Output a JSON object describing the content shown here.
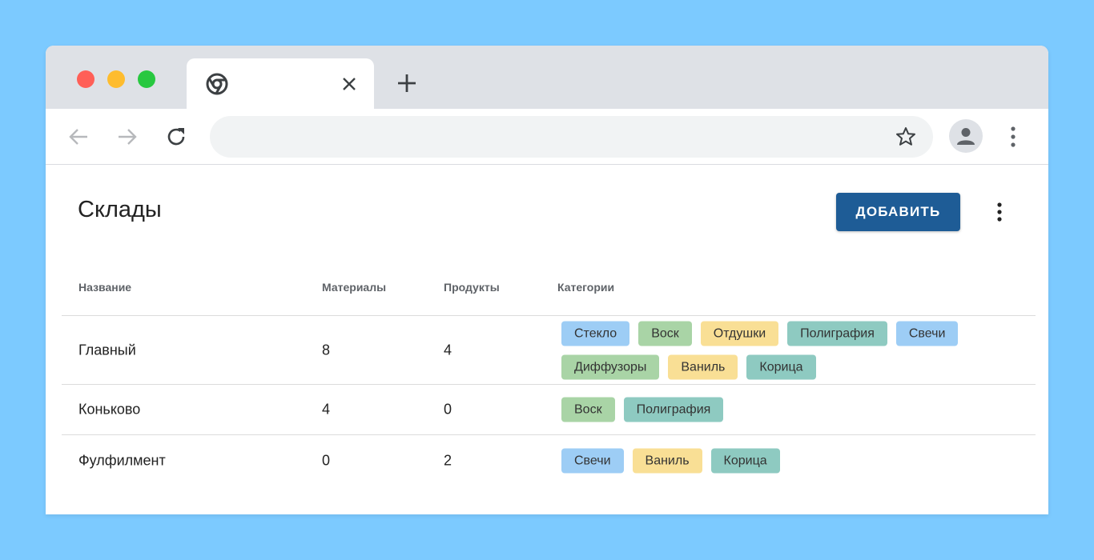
{
  "browser": {
    "traffic_light_colors": [
      "#ff5f57",
      "#febc2e",
      "#28c840"
    ],
    "close_glyph": "✕",
    "new_tab_glyph": "+"
  },
  "page": {
    "title": "Склады",
    "add_button_label": "ДОБАВИТЬ",
    "accent_color": "#1e5c96"
  },
  "table": {
    "columns": [
      "Название",
      "Материалы",
      "Продукты",
      "Категории"
    ],
    "rows": [
      {
        "name": "Главный",
        "materials": "8",
        "products": "4",
        "categories": [
          {
            "label": "Стекло",
            "color": "#9dcdf5"
          },
          {
            "label": "Воск",
            "color": "#a9d4a6"
          },
          {
            "label": "Отдушки",
            "color": "#f9df95"
          },
          {
            "label": "Полиграфия",
            "color": "#8ecac1"
          },
          {
            "label": "Свечи",
            "color": "#9dcdf5"
          },
          {
            "label": "Диффузоры",
            "color": "#a9d4a6"
          },
          {
            "label": "Ваниль",
            "color": "#f9df95"
          },
          {
            "label": "Корица",
            "color": "#8ecac1"
          }
        ]
      },
      {
        "name": "Коньково",
        "materials": "4",
        "products": "0",
        "categories": [
          {
            "label": "Воск",
            "color": "#a9d4a6"
          },
          {
            "label": "Полиграфия",
            "color": "#8ecac1"
          }
        ]
      },
      {
        "name": "Фулфилмент",
        "materials": "0",
        "products": "2",
        "categories": [
          {
            "label": "Свечи",
            "color": "#9dcdf5"
          },
          {
            "label": "Ваниль",
            "color": "#f9df95"
          },
          {
            "label": "Корица",
            "color": "#8ecac1"
          }
        ]
      }
    ]
  }
}
